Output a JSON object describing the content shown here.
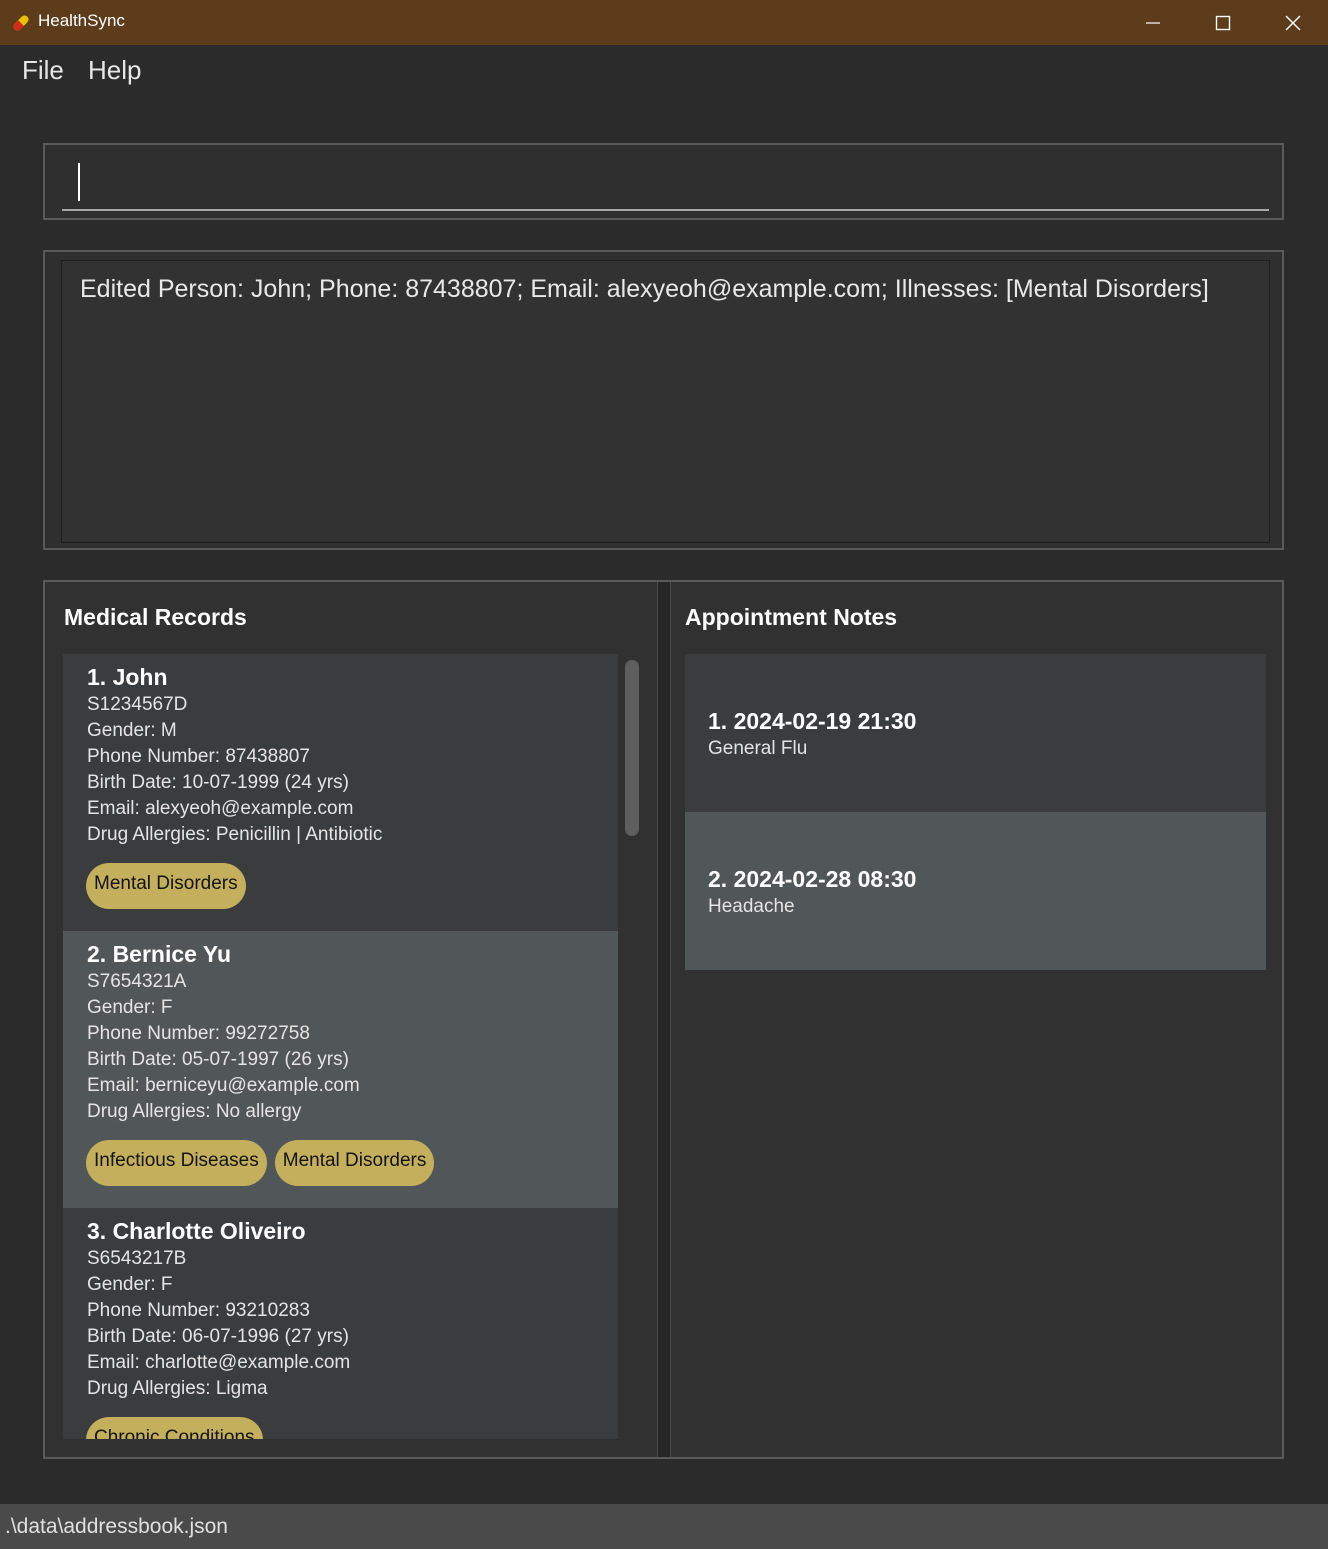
{
  "window": {
    "title": "HealthSync",
    "icon": "pill-icon"
  },
  "menu": {
    "file": "File",
    "help": "Help"
  },
  "command": {
    "value": "",
    "placeholder": ""
  },
  "result": {
    "text": "Edited Person: John; Phone: 87438807; Email: alexyeoh@example.com; Illnesses: [Mental Disorders]"
  },
  "records": {
    "title": "Medical Records",
    "items": [
      {
        "name": "1.  John",
        "nric": "S1234567D",
        "gender": "Gender: M",
        "phone": "Phone Number: 87438807",
        "birth": "Birth Date: 10-07-1999 (24 yrs)",
        "email": "Email: alexyeoh@example.com",
        "allergies": "Drug Allergies: Penicillin | Antibiotic",
        "tags": [
          "Mental Disorders"
        ]
      },
      {
        "name": "2.  Bernice Yu",
        "nric": "S7654321A",
        "gender": "Gender: F",
        "phone": "Phone Number: 99272758",
        "birth": "Birth Date: 05-07-1997 (26 yrs)",
        "email": "Email: berniceyu@example.com",
        "allergies": "Drug Allergies: No allergy",
        "tags": [
          "Infectious Diseases",
          "Mental Disorders"
        ]
      },
      {
        "name": "3.  Charlotte Oliveiro",
        "nric": "S6543217B",
        "gender": "Gender: F",
        "phone": "Phone Number: 93210283",
        "birth": "Birth Date: 06-07-1996 (27 yrs)",
        "email": "Email: charlotte@example.com",
        "allergies": "Drug Allergies: Ligma",
        "tags": [
          "Chronic Conditions"
        ]
      }
    ]
  },
  "notes": {
    "title": "Appointment Notes",
    "items": [
      {
        "title": "1.  2024-02-19 21:30",
        "description": "General Flu"
      },
      {
        "title": "2.  2024-02-28 08:30",
        "description": "Headache"
      }
    ]
  },
  "status": {
    "path": ".\\data\\addressbook.json"
  },
  "colors": {
    "titlebar": "#5c3c1a",
    "tag": "#c4af5c",
    "card_dark": "#3b3c3e",
    "card_light": "#515658"
  }
}
